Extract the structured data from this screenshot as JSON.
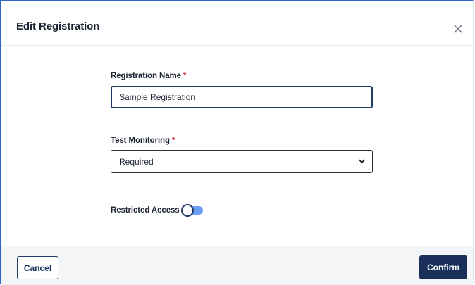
{
  "dialog": {
    "title": "Edit Registration",
    "close_icon": "close-icon"
  },
  "form": {
    "registration_name": {
      "label": "Registration Name",
      "required_marker": "*",
      "value": "Sample Registration"
    },
    "test_monitoring": {
      "label": "Test Monitoring",
      "required_marker": "*",
      "selected": "Required",
      "chevron_icon": "chevron-down-icon"
    },
    "restricted_access": {
      "label": "Restricted Access",
      "enabled": false
    }
  },
  "footer": {
    "cancel_label": "Cancel",
    "confirm_label": "Confirm"
  },
  "colors": {
    "primary": "#1a2f5a",
    "required": "#c8323c",
    "toggle_track": "#6c9ef5"
  }
}
